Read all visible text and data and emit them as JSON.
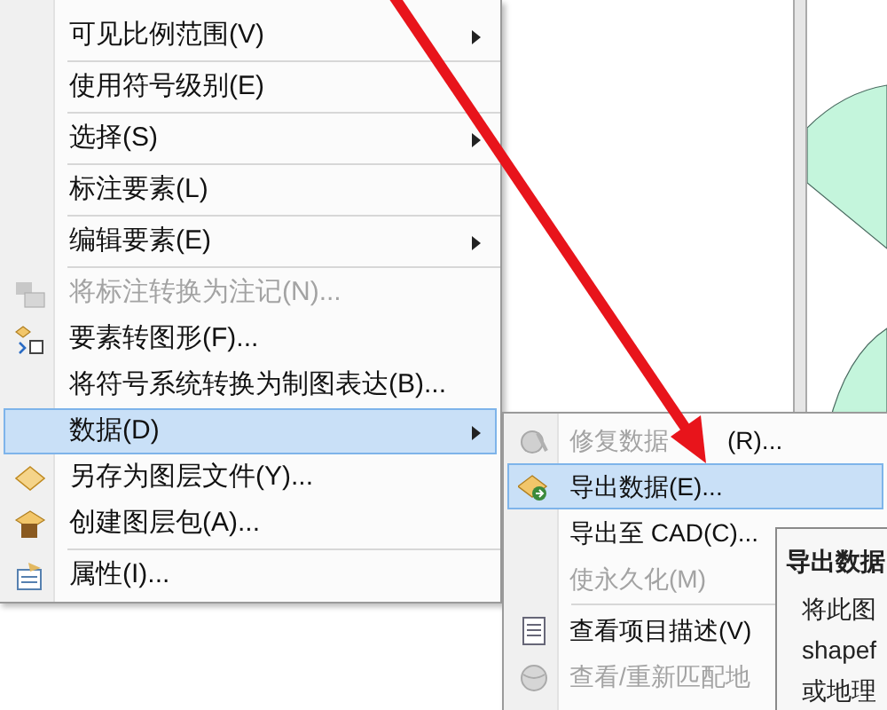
{
  "context_menu": {
    "items": [
      {
        "kind": "item",
        "label": "可见比例范围(V)",
        "submenu": true,
        "disabled": false,
        "selected": false
      },
      {
        "kind": "separator"
      },
      {
        "kind": "item",
        "label": "使用符号级别(E)",
        "submenu": false,
        "disabled": false,
        "selected": false
      },
      {
        "kind": "separator"
      },
      {
        "kind": "item",
        "label": "选择(S)",
        "submenu": true,
        "disabled": false,
        "selected": false
      },
      {
        "kind": "separator"
      },
      {
        "kind": "item",
        "label": "标注要素(L)",
        "submenu": false,
        "disabled": false,
        "selected": false
      },
      {
        "kind": "separator"
      },
      {
        "kind": "item",
        "label": "编辑要素(E)",
        "submenu": true,
        "disabled": false,
        "selected": false
      },
      {
        "kind": "separator"
      },
      {
        "kind": "item",
        "label": "将标注转换为注记(N)...",
        "submenu": false,
        "disabled": true,
        "selected": false
      },
      {
        "kind": "item",
        "label": "要素转图形(F)...",
        "submenu": false,
        "disabled": false,
        "selected": false
      },
      {
        "kind": "item",
        "label": "将符号系统转换为制图表达(B)...",
        "submenu": false,
        "disabled": false,
        "selected": false
      },
      {
        "kind": "item",
        "label": "数据(D)",
        "submenu": true,
        "disabled": false,
        "selected": true
      },
      {
        "kind": "item",
        "label": "另存为图层文件(Y)...",
        "submenu": false,
        "disabled": false,
        "selected": false
      },
      {
        "kind": "item",
        "label": "创建图层包(A)...",
        "submenu": false,
        "disabled": false,
        "selected": false
      },
      {
        "kind": "separator"
      },
      {
        "kind": "item",
        "label": "属性(I)...",
        "submenu": false,
        "disabled": false,
        "selected": false
      }
    ]
  },
  "submenu": {
    "items": [
      {
        "kind": "item",
        "label": "修复数据",
        "label_after": "(R)...",
        "disabled": true,
        "selected": false
      },
      {
        "kind": "item",
        "label": "导出数据(E)...",
        "disabled": false,
        "selected": true
      },
      {
        "kind": "item",
        "label": "导出至 CAD(C)...",
        "disabled": false,
        "selected": false
      },
      {
        "kind": "item",
        "label": "使永久化(M)",
        "disabled": true,
        "selected": false
      },
      {
        "kind": "separator"
      },
      {
        "kind": "item",
        "label": "查看项目描述(V)",
        "disabled": false,
        "selected": false
      },
      {
        "kind": "item",
        "label": "查看/重新匹配地",
        "disabled": true,
        "selected": false
      }
    ]
  },
  "tooltip": {
    "title": "导出数据",
    "lines": [
      "将此图",
      "shapef",
      "或地理"
    ]
  }
}
